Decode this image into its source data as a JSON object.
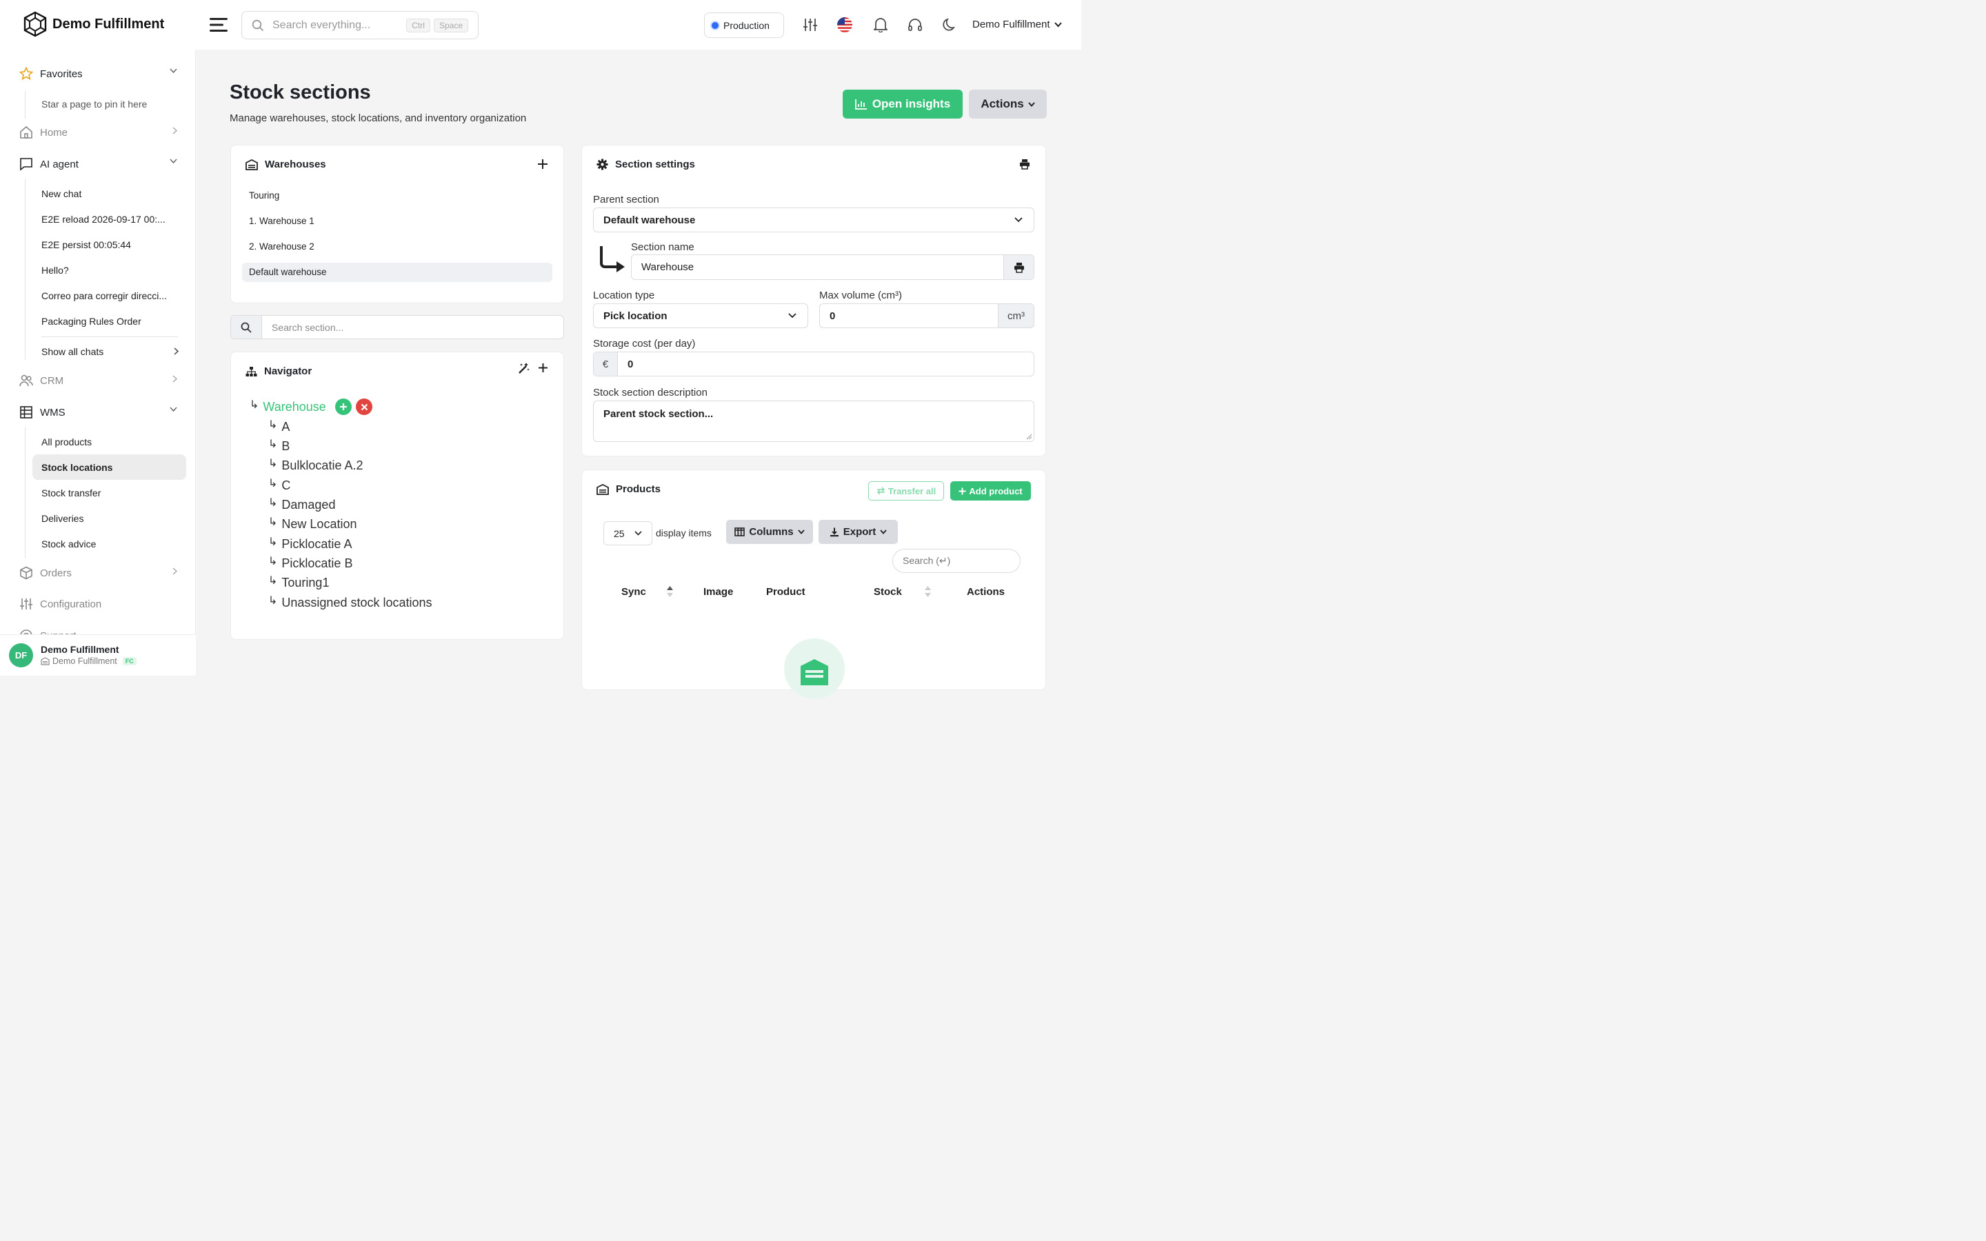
{
  "app": {
    "name": "Demo Fulfillment"
  },
  "header": {
    "search_placeholder": "Search everything...",
    "kbd1": "Ctrl",
    "kbd2": "Space",
    "environment": "Production",
    "user_name": "Demo Fulfillment"
  },
  "sidebar": {
    "favorites": "Favorites",
    "favorites_hint": "Star a page to pin it here",
    "home": "Home",
    "ai_agent": "AI agent",
    "chats": [
      "New chat",
      "E2E reload 2026-09-17 00:...",
      "E2E persist 00:05:44",
      "Hello?",
      "Correo para corregir direcci...",
      "Packaging Rules Order"
    ],
    "show_all_chats": "Show all chats",
    "crm": "CRM",
    "wms": "WMS",
    "wms_items": [
      "All products",
      "Stock locations",
      "Stock transfer",
      "Deliveries",
      "Stock advice"
    ],
    "orders": "Orders",
    "configuration": "Configuration",
    "support": "Support",
    "footer_name": "Demo Fulfillment",
    "footer_org": "Demo Fulfillment",
    "footer_badge": "FC",
    "avatar_initials": "DF"
  },
  "page": {
    "title": "Stock sections",
    "subtitle": "Manage warehouses, stock locations, and inventory organization",
    "open_insights": "Open insights",
    "actions": "Actions"
  },
  "warehouses": {
    "title": "Warehouses",
    "items": [
      "Touring",
      "1. Warehouse 1",
      "2. Warehouse 2",
      "Default warehouse"
    ]
  },
  "section_search": {
    "placeholder": "Search section..."
  },
  "navigator": {
    "title": "Navigator",
    "root": "Warehouse",
    "children": [
      "A",
      "B",
      "Bulklocatie A.2",
      "C",
      "Damaged",
      "New Location",
      "Picklocatie A",
      "Picklocatie B",
      "Touring1",
      "Unassigned stock locations"
    ]
  },
  "settings": {
    "title": "Section settings",
    "parent_label": "Parent section",
    "parent_value": "Default warehouse",
    "name_label": "Section name",
    "name_value": "Warehouse",
    "location_type_label": "Location type",
    "location_type_value": "Pick location",
    "max_volume_label": "Max volume (cm³)",
    "max_volume_value": "0",
    "max_volume_unit": "cm³",
    "storage_cost_label": "Storage cost (per day)",
    "currency": "€",
    "storage_cost_value": "0",
    "description_label": "Stock section description",
    "description_placeholder": "Parent stock section..."
  },
  "products": {
    "title": "Products",
    "transfer_all": "Transfer all",
    "add_product": "Add product",
    "page_size": "25",
    "display_items": "display items",
    "columns": "Columns",
    "export": "Export",
    "search_placeholder": "Search (↵)",
    "columns_headers": [
      "Sync",
      "Image",
      "Product",
      "Stock",
      "Actions"
    ]
  },
  "colors": {
    "accent": "#37c27a",
    "danger": "#e0463f",
    "env_dot": "#2d6cf6"
  }
}
